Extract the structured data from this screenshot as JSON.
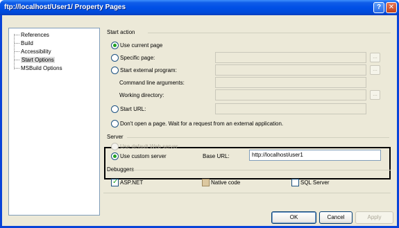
{
  "window": {
    "title": "ftp://localhost/User1/ Property Pages",
    "help_glyph": "?",
    "close_glyph": "✕"
  },
  "nav": {
    "items": [
      {
        "label": "References",
        "selected": false
      },
      {
        "label": "Build",
        "selected": false
      },
      {
        "label": "Accessibility",
        "selected": false
      },
      {
        "label": "Start Options",
        "selected": true
      },
      {
        "label": "MSBuild Options",
        "selected": false
      }
    ]
  },
  "start_action": {
    "title": "Start action",
    "use_current_page": "Use current page",
    "specific_page": "Specific page:",
    "start_external_program": "Start external program:",
    "command_line_arguments": "Command line arguments:",
    "working_directory": "Working directory:",
    "start_url": "Start URL:",
    "dont_open": "Don't open a page.  Wait for a request from an external application.",
    "browse_label": "...",
    "selected": "use_current_page"
  },
  "server": {
    "title": "Server",
    "use_default": "Use default Web server",
    "use_custom": "Use custom server",
    "base_url_label": "Base URL:",
    "base_url_value": "http://localhost/user1",
    "selected": "use_custom"
  },
  "debuggers": {
    "title": "Debuggers",
    "aspnet": {
      "label": "ASP.NET",
      "checked": true
    },
    "native": {
      "label": "Native code",
      "checked": false
    },
    "sql": {
      "label": "SQL Server",
      "checked": false
    }
  },
  "buttons": {
    "ok": "OK",
    "cancel": "Cancel",
    "apply": "Apply"
  }
}
